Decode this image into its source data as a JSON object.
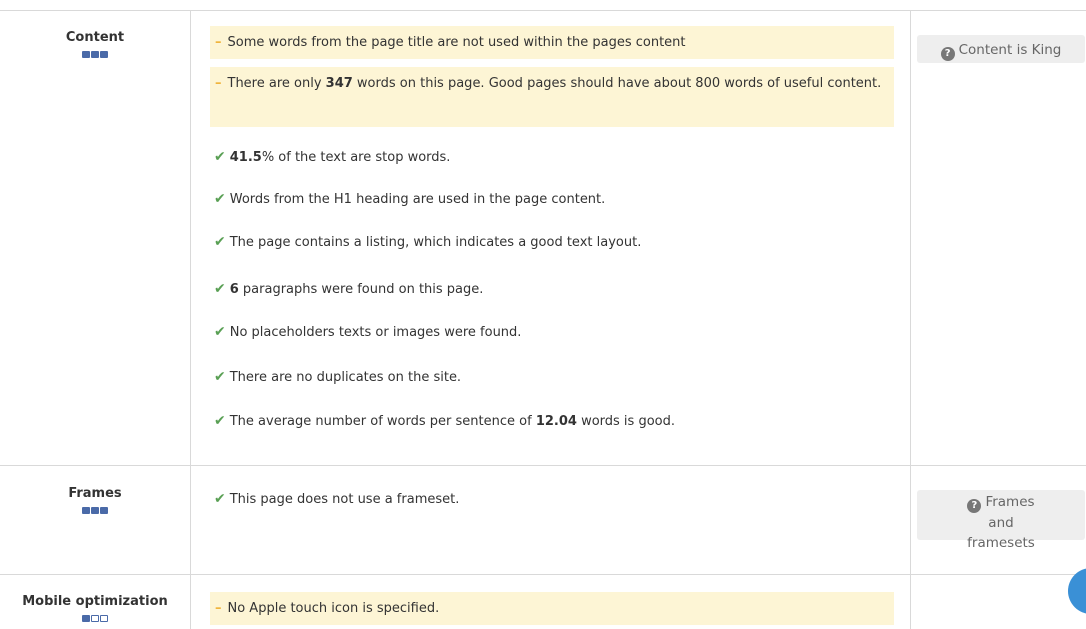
{
  "sections": {
    "content": {
      "title": "Content",
      "rating": 3,
      "warnings": [
        {
          "text": "Some words from the page title are not used within the pages content"
        },
        {
          "pre": "There are only ",
          "bold": "347",
          "post": " words on this page. Good pages should have about 800 words of useful content."
        }
      ],
      "checks": [
        {
          "pre": "",
          "bold": "41.5",
          "post": "% of the text are stop words."
        },
        {
          "pre": "Words from the H1 heading are used in the page content.",
          "bold": "",
          "post": ""
        },
        {
          "pre": "The page contains a listing, which indicates a good text layout.",
          "bold": "",
          "post": ""
        },
        {
          "pre": "",
          "bold": "6",
          "post": " paragraphs were found on this page."
        },
        {
          "pre": "No placeholders texts or images were found.",
          "bold": "",
          "post": ""
        },
        {
          "pre": "There are no duplicates on the site.",
          "bold": "",
          "post": ""
        },
        {
          "pre": "The average number of words per sentence of ",
          "bold": "12.04",
          "post": " words is good."
        }
      ],
      "help_label": "Content is King"
    },
    "frames": {
      "title": "Frames",
      "rating": 3,
      "checks": [
        {
          "pre": "This page does not use a frameset.",
          "bold": "",
          "post": ""
        }
      ],
      "help_label": "Frames and framesets"
    },
    "mobile": {
      "title": "Mobile optimization",
      "rating": 1,
      "warnings": [
        {
          "text": "No Apple touch icon is specified."
        }
      ]
    }
  },
  "icons": {
    "warning": "dash-icon",
    "check": "checkmark-icon",
    "help": "question-circle-icon"
  },
  "colors": {
    "warning_bg": "#fdf5d5",
    "warning_dash": "#f0b43c",
    "check": "#5aa055",
    "rating": "#4a6aa8",
    "fab": "#3a90d6"
  }
}
